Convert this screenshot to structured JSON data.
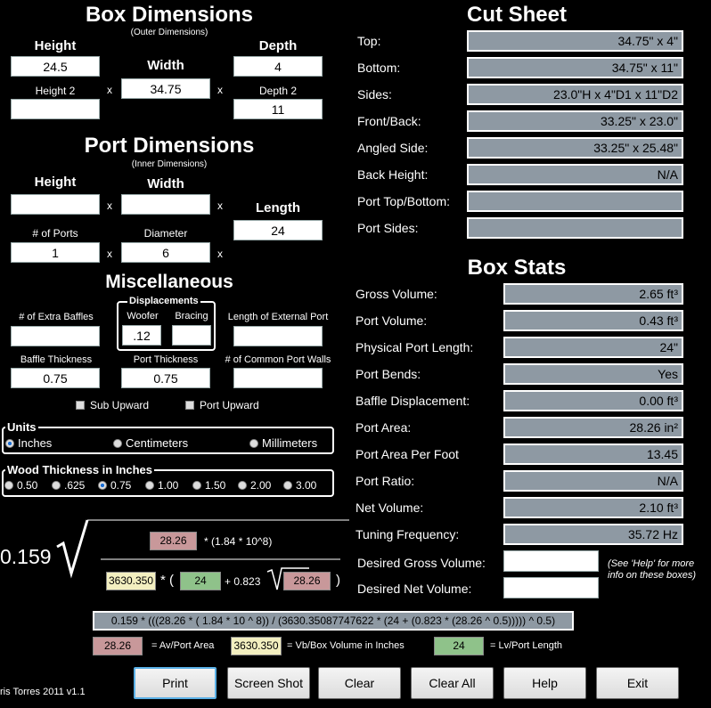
{
  "box": {
    "title": "Box Dimensions",
    "subtitle": "(Outer Dimensions)",
    "height_label": "Height",
    "width_label": "Width",
    "depth_label": "Depth",
    "height2_label": "Height 2",
    "depth2_label": "Depth 2",
    "x": "x",
    "height": "24.5",
    "width": "34.75",
    "depth": "4",
    "height2": "",
    "depth2": "11"
  },
  "port": {
    "title": "Port Dimensions",
    "subtitle": "(Inner Dimensions)",
    "height_label": "Height",
    "width_label": "Width",
    "length_label": "Length",
    "num_ports_label": "# of Ports",
    "diameter_label": "Diameter",
    "height": "",
    "width": "",
    "length": "24",
    "num_ports": "1",
    "diameter": "6"
  },
  "misc": {
    "title": "Miscellaneous",
    "displacements_label": "Displacements",
    "extra_baffles_label": "# of Extra Baffles",
    "woofer_label": "Woofer",
    "bracing_label": "Bracing",
    "ext_port_label": "Length of External Port",
    "baffle_thickness_label": "Baffle Thickness",
    "port_thickness_label": "Port Thickness",
    "common_walls_label": "# of Common Port Walls",
    "extra_baffles": "",
    "woofer": ".12",
    "bracing": "",
    "ext_port": "",
    "baffle_thickness": "0.75",
    "port_thickness": "0.75",
    "common_walls": "",
    "sub_upward": "Sub Upward",
    "port_upward": "Port Upward"
  },
  "units": {
    "label": "Units",
    "options": [
      "Inches",
      "Centimeters",
      "Millimeters"
    ],
    "selected": "Inches"
  },
  "wood": {
    "label": "Wood Thickness in Inches",
    "options": [
      "0.50",
      ".625",
      "0.75",
      "1.00",
      "1.50",
      "2.00",
      "3.00"
    ],
    "selected": "0.75"
  },
  "cut_sheet": {
    "title": "Cut Sheet",
    "rows": [
      {
        "label": "Top:",
        "value": "34.75\" x 4\""
      },
      {
        "label": "Bottom:",
        "value": "34.75\" x 11\""
      },
      {
        "label": "Sides:",
        "value": "23.0\"H x 4\"D1 x 11\"D2"
      },
      {
        "label": "Front/Back:",
        "value": "33.25\" x 23.0\""
      },
      {
        "label": "Angled Side:",
        "value": "33.25\" x 25.48\""
      },
      {
        "label": "Back Height:",
        "value": "N/A"
      },
      {
        "label": "Port Top/Bottom:",
        "value": ""
      },
      {
        "label": "Port Sides:",
        "value": ""
      }
    ]
  },
  "stats": {
    "title": "Box Stats",
    "rows": [
      {
        "label": "Gross Volume:",
        "value": "2.65 ft³"
      },
      {
        "label": "Port Volume:",
        "value": "0.43 ft³"
      },
      {
        "label": "Physical Port Length:",
        "value": "24\""
      },
      {
        "label": "Port Bends:",
        "value": "Yes"
      },
      {
        "label": "Baffle Displacement:",
        "value": "0.00 ft³"
      },
      {
        "label": "Port Area:",
        "value": "28.26 in²"
      },
      {
        "label": "Port Area Per Foot",
        "value": "13.45"
      },
      {
        "label": "Port Ratio:",
        "value": "N/A"
      },
      {
        "label": "Net Volume:",
        "value": "2.10 ft³"
      },
      {
        "label": "Tuning Frequency:",
        "value": "35.72 Hz"
      }
    ],
    "desired_gross_label": "Desired Gross Volume:",
    "desired_net_label": "Desired Net Volume:",
    "desired_gross": "",
    "desired_net": "",
    "help_note": "(See 'Help' for more info on these boxes)"
  },
  "formula": {
    "coef": "0.159",
    "av": "28.26",
    "num_tail": "* (1.84 * 10^8)",
    "vb": "3630.350",
    "star_paren": "* (",
    "lv": "24",
    "plus": "+ 0.823",
    "av2": "28.26",
    "close": ")",
    "expression": "0.159 * (((28.26 * ( 1.84 * 10 ^ 8)) / (3630.35087747622 * (24 + (0.823 * (28.26 ^ 0.5))))) ^ 0.5)",
    "legend_av": "28.26",
    "legend_av_text": "= Av/Port Area",
    "legend_vb": "3630.350",
    "legend_vb_text": "= Vb/Box Volume in Inches",
    "legend_lv": "24",
    "legend_lv_text": "= Lv/Port Length"
  },
  "footer": {
    "credit": "ris Torres 2011 v1.1",
    "buttons": [
      "Print",
      "Screen Shot",
      "Clear",
      "Clear All",
      "Help",
      "Exit"
    ]
  },
  "colors": {
    "stat_box": "#8e99a3",
    "av_chip": "#c8989a",
    "vb_chip": "#f3efc0",
    "lv_chip": "#8fc28a"
  }
}
